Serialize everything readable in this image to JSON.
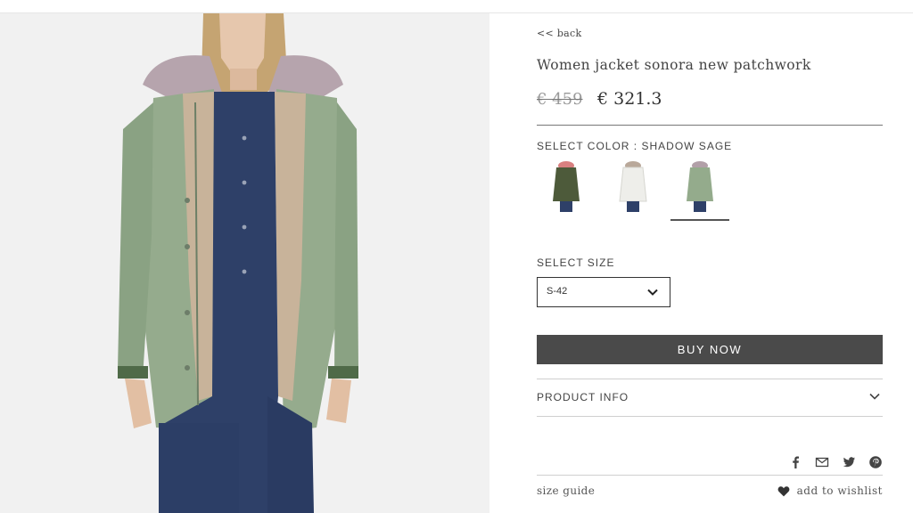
{
  "nav": {
    "back_label": "<< back"
  },
  "product": {
    "title": "Women jacket sonora new patchwork",
    "price_old": "€ 459",
    "price_new": "€ 321.3",
    "image_icon": "product-photo-parka"
  },
  "color": {
    "label": "SELECT COLOR : SHADOW SAGE",
    "options": [
      {
        "name": "olive-swatch",
        "jacket_color": "#4d5a3a",
        "fur_color": "#d98080"
      },
      {
        "name": "white-swatch",
        "jacket_color": "#eeeeea",
        "fur_color": "#b9a89a"
      },
      {
        "name": "sage-swatch",
        "jacket_color": "#94ab8c",
        "fur_color": "#b2a0a8",
        "selected": true
      }
    ]
  },
  "size": {
    "label": "SELECT SIZE",
    "selected": "S-42"
  },
  "buy_label": "BUY NOW",
  "product_info_label": "PRODUCT INFO",
  "share_icons": [
    "facebook-icon",
    "email-icon",
    "twitter-icon",
    "pinterest-icon"
  ],
  "size_guide_label": "size guide",
  "wishlist_label": "add to wishlist",
  "colors": {
    "button_bg": "#4a4a4a",
    "jacket": "#95ab8d",
    "denim": "#2e4068"
  }
}
